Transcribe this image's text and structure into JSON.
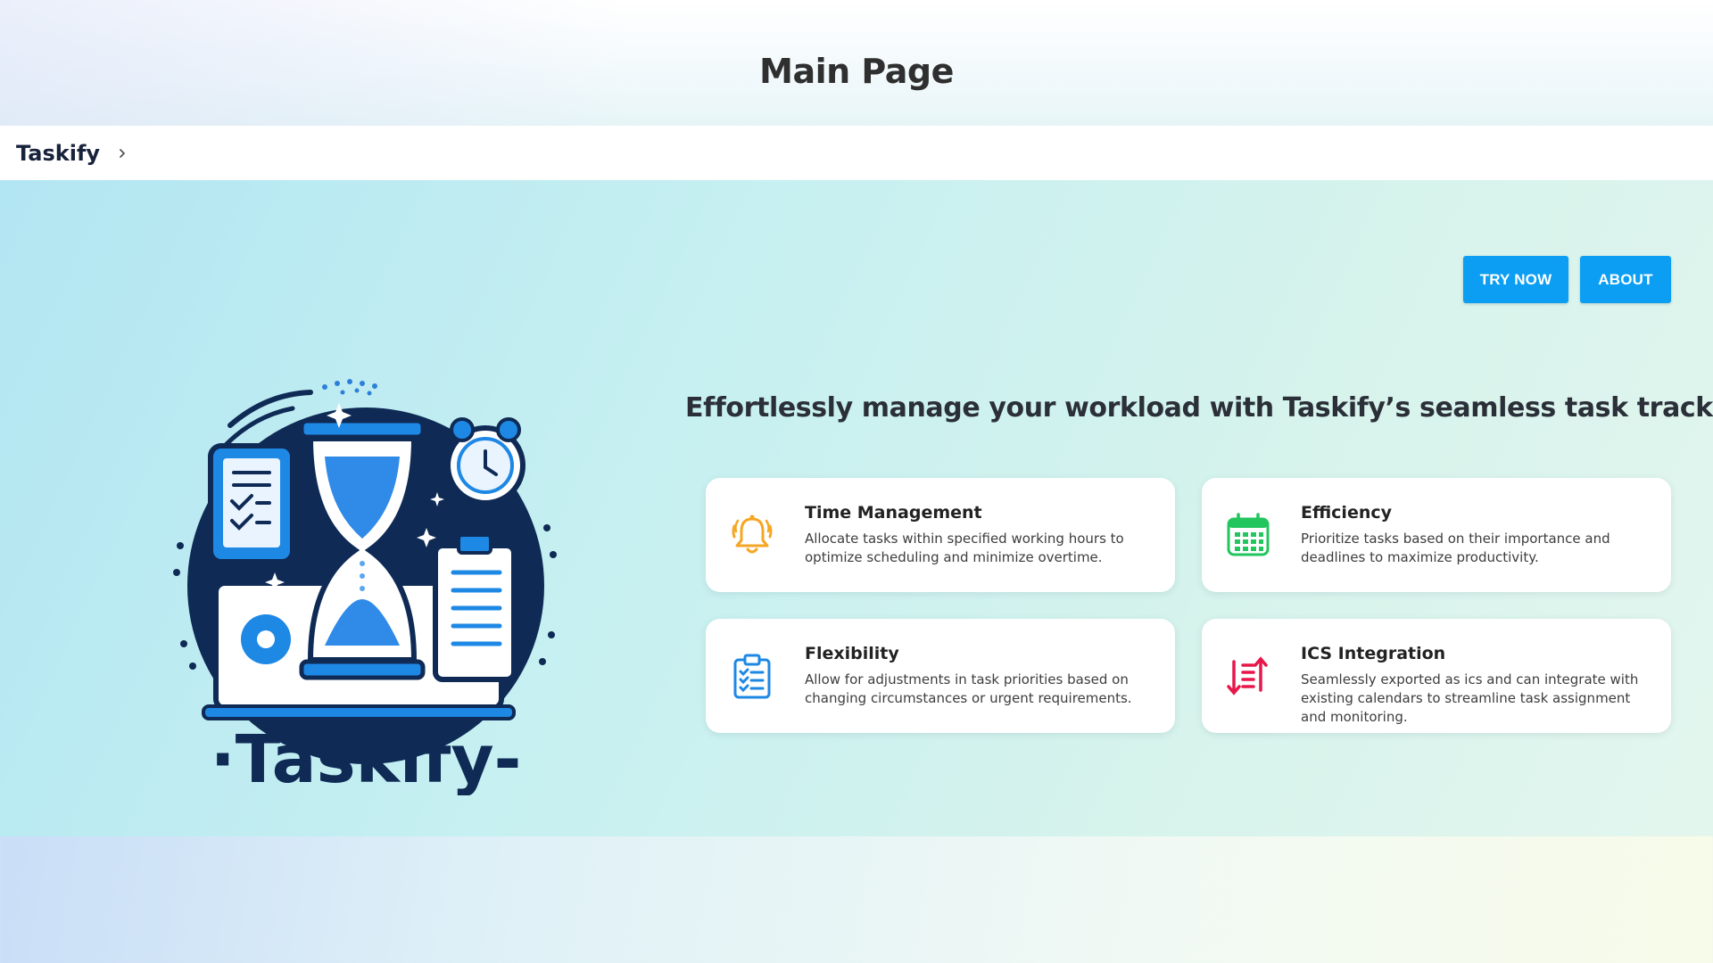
{
  "header": {
    "title": "Main Page"
  },
  "breadcrumb": {
    "brand": "Taskify"
  },
  "hero": {
    "buttons": {
      "try_now": "TRY NOW",
      "about": "ABOUT"
    },
    "headline": "Effortlessly manage your workload with Taskify’s seamless task tracking.",
    "logo_text": "·Taskify-"
  },
  "features": [
    {
      "icon": "bell-icon",
      "title": "Time Management",
      "description": "Allocate tasks within specified working hours to optimize scheduling and minimize overtime."
    },
    {
      "icon": "calendar-icon",
      "title": "Efficiency",
      "description": "Prioritize tasks based on their importance and deadlines to maximize productivity."
    },
    {
      "icon": "clipboard-icon",
      "title": "Flexibility",
      "description": "Allow for adjustments in task priorities based on changing circumstances or urgent requirements."
    },
    {
      "icon": "sort-list-icon",
      "title": "ICS Integration",
      "description": "Seamlessly exported as ics and can integrate with existing calendars to streamline task assignment and monitoring."
    }
  ],
  "colors": {
    "button": "#0b9ef3",
    "bell_icon": "#f5a623",
    "calendar_icon": "#22c55e",
    "clipboard_icon": "#1e88e5",
    "sort_icon": "#e8174a",
    "brand_navy": "#17223b"
  }
}
